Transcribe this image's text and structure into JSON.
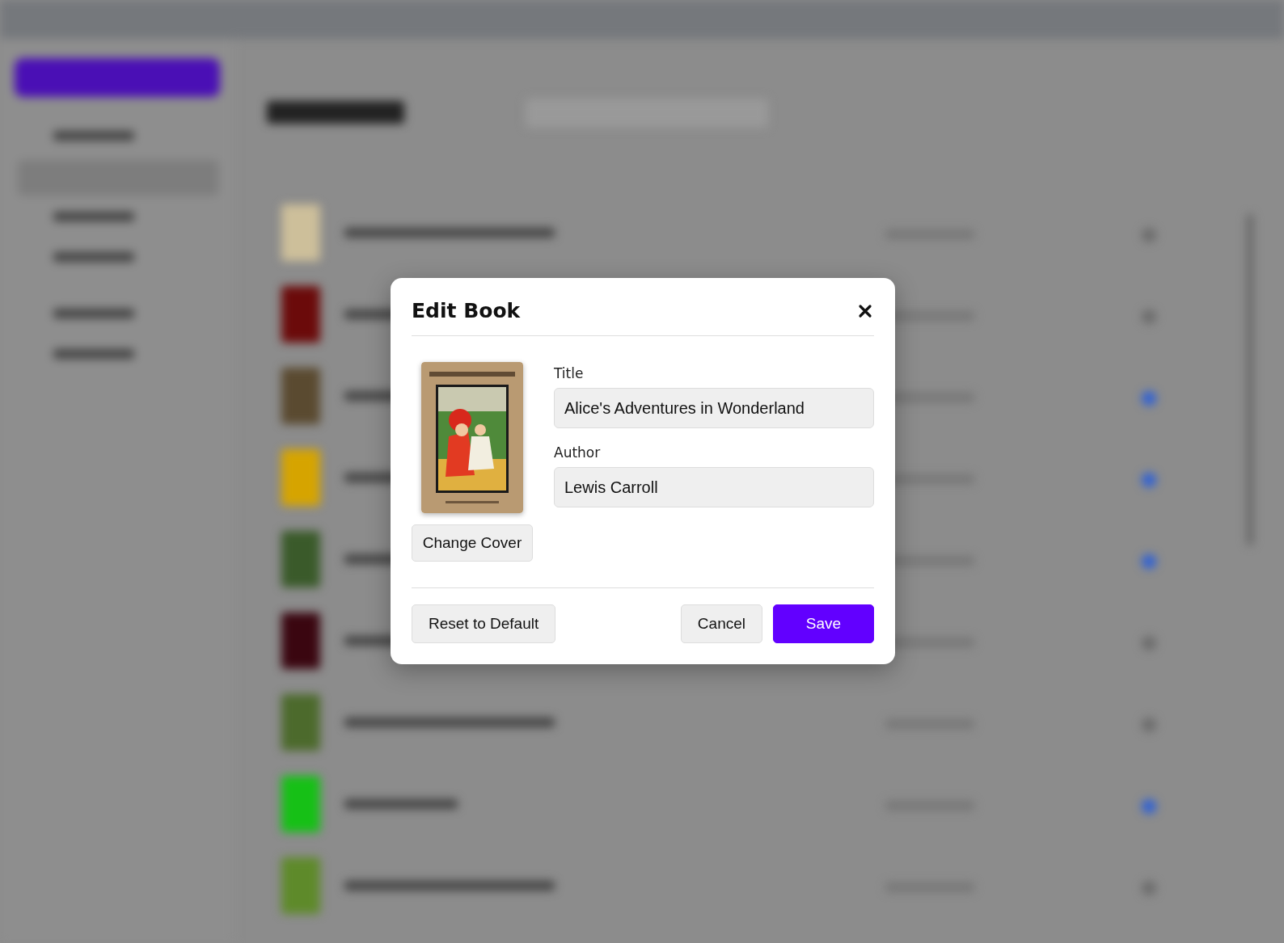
{
  "dialog": {
    "title": "Edit Book",
    "change_cover_button": "Change Cover",
    "fields": [
      {
        "label": "Title",
        "value": "Alice's Adventures in Wonderland"
      },
      {
        "label": "Author",
        "value": "Lewis Carroll"
      }
    ],
    "buttons": [
      {
        "label": "Reset to Default",
        "kind": "secondary"
      },
      {
        "label": "Cancel",
        "kind": "secondary"
      },
      {
        "label": "Save",
        "kind": "primary"
      }
    ]
  }
}
